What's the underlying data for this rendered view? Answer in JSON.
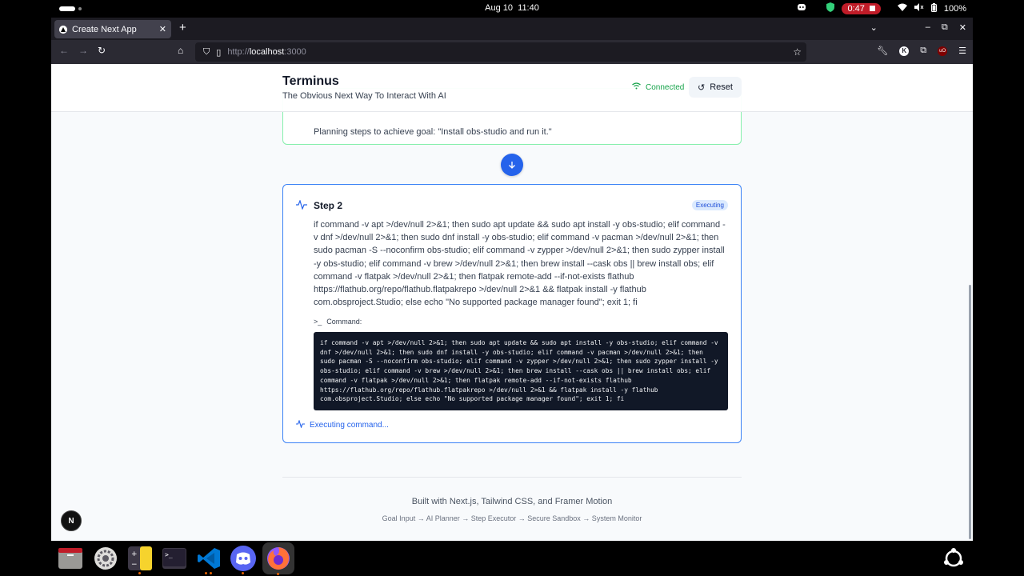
{
  "system": {
    "date": "Aug 10",
    "time": "11:40",
    "recording_time": "0:47",
    "battery": "100%"
  },
  "browser": {
    "tab_title": "Create Next App",
    "url_prefix": "http://",
    "url_host": "localhost",
    "url_suffix": ":3000"
  },
  "header": {
    "title": "Terminus",
    "subtitle": "The Obvious Next Way To Interact With AI",
    "status": "Connected",
    "reset_label": "Reset"
  },
  "step1": {
    "description": "Planning steps to achieve goal: \"Install obs-studio and run it.\""
  },
  "step2": {
    "title": "Step 2",
    "status_badge": "Executing",
    "description": "if command -v apt >/dev/null 2>&1; then sudo apt update && sudo apt install -y obs-studio; elif command -v dnf >/dev/null 2>&1; then sudo dnf install -y obs-studio; elif command -v pacman >/dev/null 2>&1; then sudo pacman -S --noconfirm obs-studio; elif command -v zypper >/dev/null 2>&1; then sudo zypper install -y obs-studio; elif command -v brew >/dev/null 2>&1; then brew install --cask obs || brew install obs; elif command -v flatpak >/dev/null 2>&1; then flatpak remote-add --if-not-exists flathub https://flathub.org/repo/flathub.flatpakrepo >/dev/null 2>&1 && flatpak install -y flathub com.obsproject.Studio; else echo \"No supported package manager found\"; exit 1; fi",
    "command_label": "Command:",
    "command": "if command -v apt >/dev/null 2>&1; then sudo apt update && sudo apt install -y obs-studio; elif command -v dnf >/dev/null 2>&1; then sudo dnf install -y obs-studio; elif command -v pacman >/dev/null 2>&1; then sudo pacman -S --noconfirm obs-studio; elif command -v zypper >/dev/null 2>&1; then sudo zypper install -y obs-studio; elif command -v brew >/dev/null 2>&1; then brew install --cask obs || brew install obs; elif command -v flatpak >/dev/null 2>&1; then flatpak remote-add --if-not-exists flathub https://flathub.org/repo/flathub.flatpakrepo >/dev/null 2>&1 && flatpak install -y flathub com.obsproject.Studio; else echo \"No supported package manager found\"; exit 1; fi",
    "executing_text": "Executing command..."
  },
  "footer": {
    "built_with": "Built with Next.js, Tailwind CSS, and Framer Motion",
    "flow": "Goal Input → AI Planner → Step Executor → Secure Sandbox → System Monitor"
  },
  "dock": {
    "apps": [
      "files-icon",
      "settings-icon",
      "calculator-icon",
      "terminal-icon",
      "vscode-icon",
      "discord-icon",
      "firefox-icon"
    ]
  },
  "colors": {
    "accent": "#2563eb",
    "success": "#16a34a",
    "recording": "#c01c28"
  }
}
